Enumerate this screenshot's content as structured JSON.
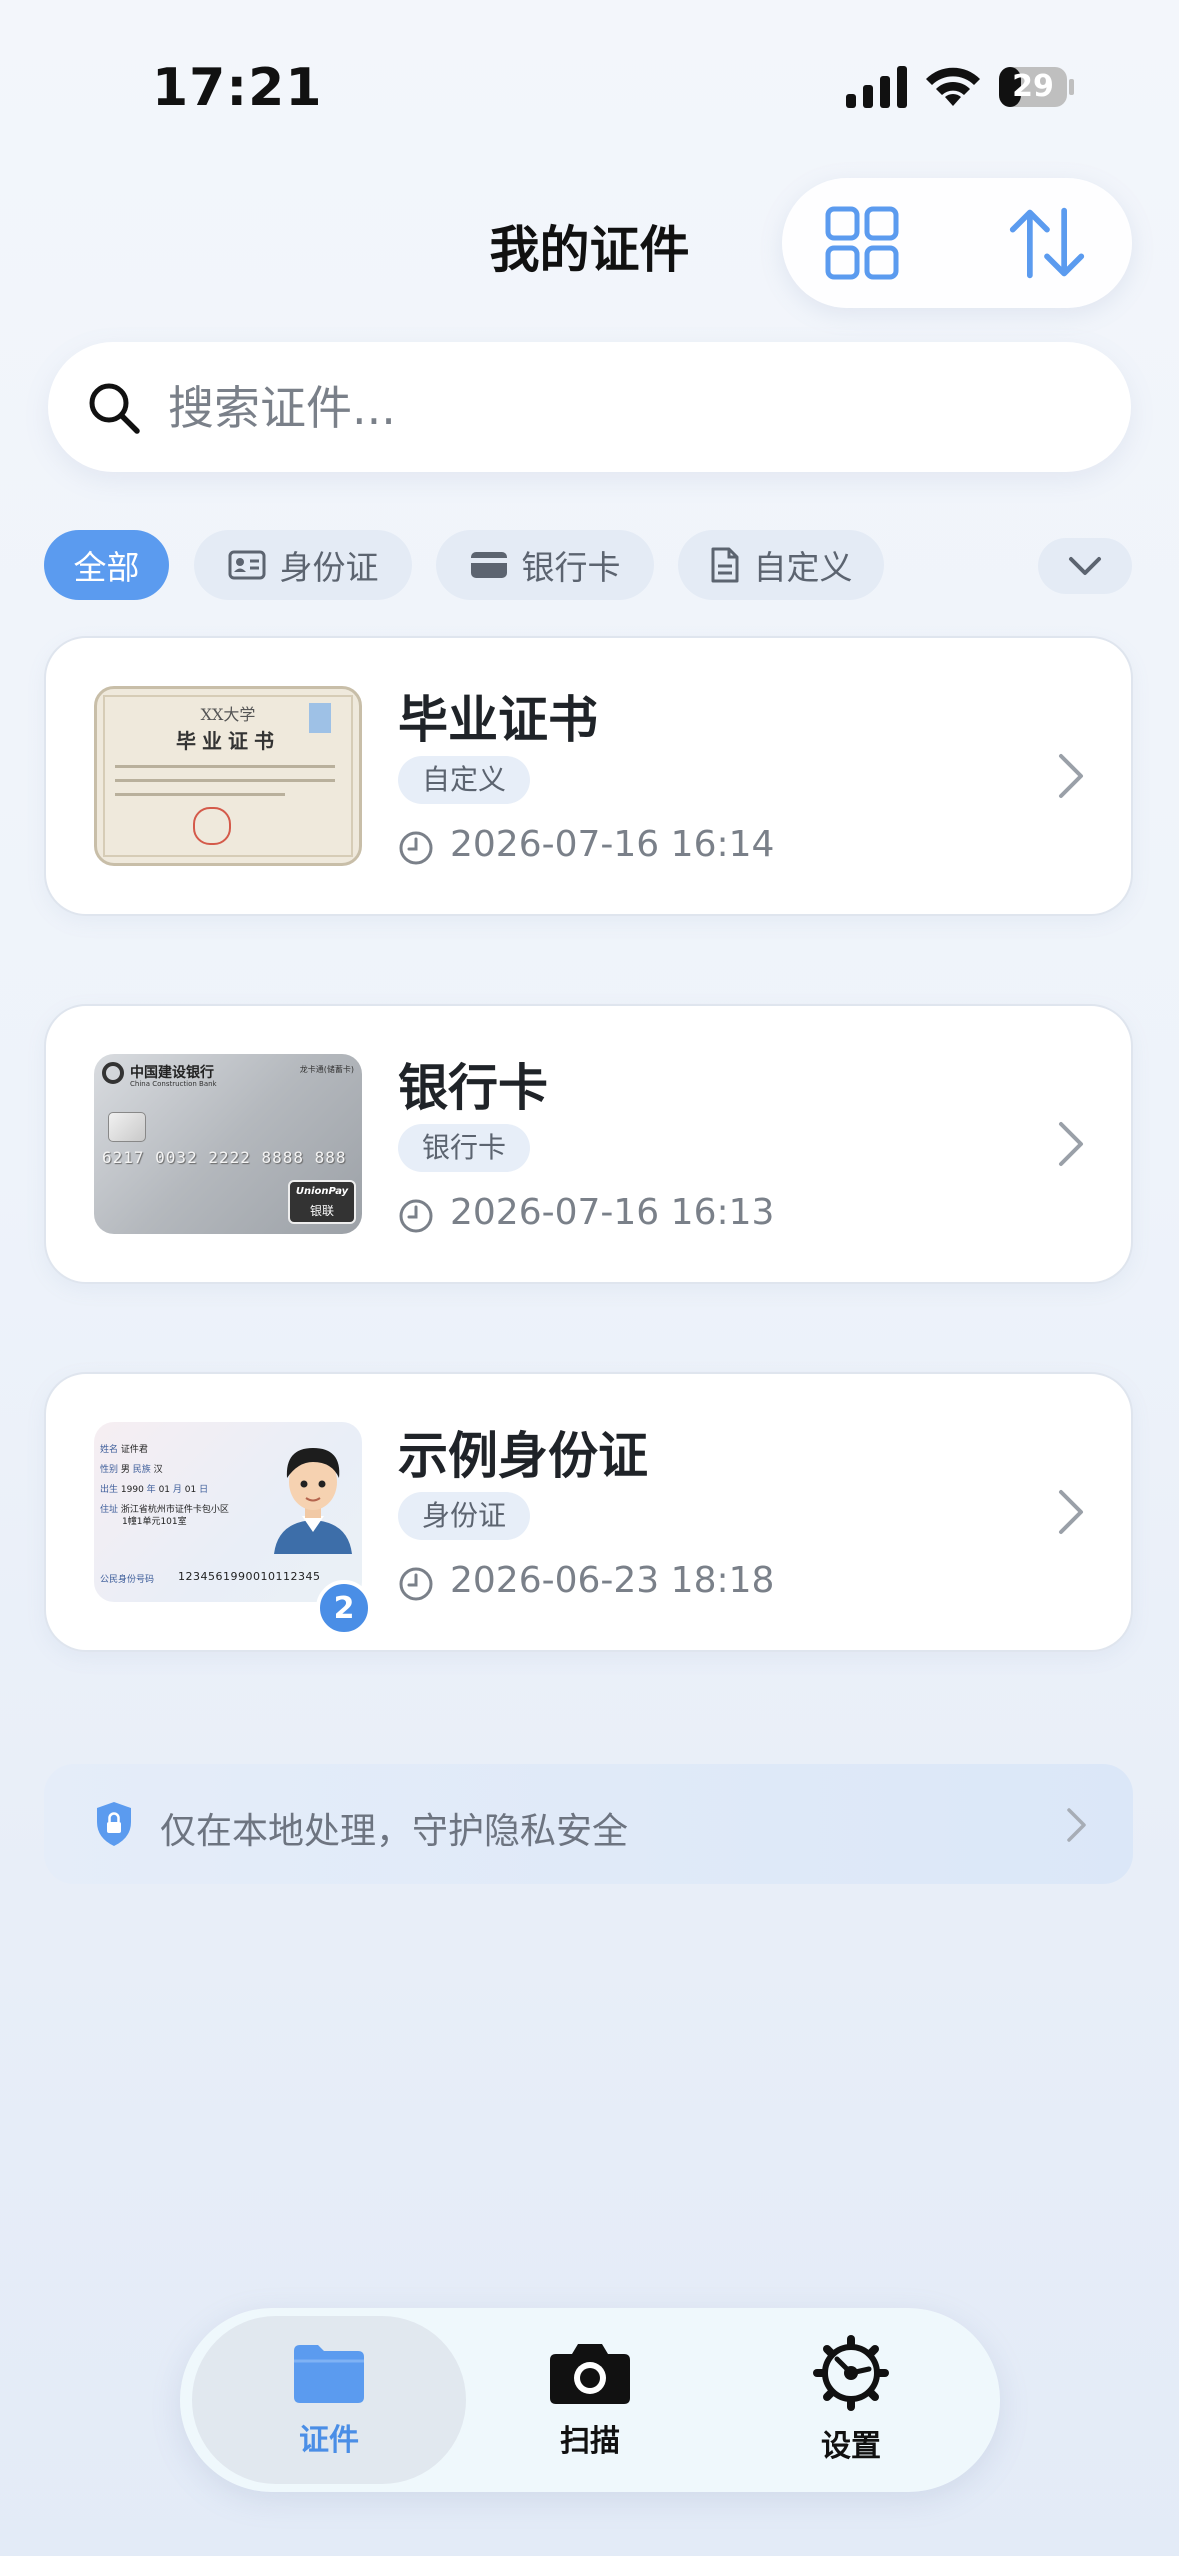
{
  "status_bar": {
    "time": "17:21",
    "battery": "29"
  },
  "header": {
    "title": "我的证件",
    "grid_icon": "grid-view-icon",
    "sort_icon": "sort-icon"
  },
  "search": {
    "placeholder": "搜索证件...",
    "icon": "search-icon"
  },
  "filters": [
    {
      "label": "全部",
      "active": true
    },
    {
      "label": "身份证",
      "icon": "id-card-icon"
    },
    {
      "label": "银行卡",
      "icon": "bank-card-icon"
    },
    {
      "label": "自定义",
      "icon": "document-icon"
    }
  ],
  "documents": [
    {
      "name": "毕业证书",
      "tag": "自定义",
      "time": "2026-07-16 16:14",
      "thumb": {
        "school": "XX大学",
        "title": "毕业证书"
      }
    },
    {
      "name": "银行卡",
      "tag": "银行卡",
      "time": "2026-07-16 16:13",
      "thumb": {
        "bank": "中国建设银行",
        "bank_en": "China Construction Bank",
        "number": "6217 0032 2222 8888 888",
        "brand": "UnionPay",
        "brand_cn": "银联",
        "card_type": "龙卡通(储蓄卡)"
      }
    },
    {
      "name": "示例身份证",
      "tag": "身份证",
      "time": "2026-06-23 18:18",
      "badge": "2",
      "thumb": {
        "name_label": "姓名",
        "name": "证件君",
        "sex_label": "性别",
        "sex": "男",
        "nation_label": "民族",
        "nation": "汉",
        "birth_label": "出生",
        "year": "1990",
        "year_unit": "年",
        "month": "01",
        "month_unit": "月",
        "day": "01",
        "day_unit": "日",
        "address_label": "住址",
        "address1": "浙江省杭州市证件卡包小区",
        "address2": "1幢1单元101室",
        "id_label": "公民身份号码",
        "id_number": "1234561990010112345"
      }
    }
  ],
  "privacy": {
    "text": "仅在本地处理，守护隐私安全",
    "icon": "lock-shield-icon"
  },
  "tabbar": [
    {
      "label": "证件",
      "icon": "folder-icon",
      "active": true
    },
    {
      "label": "扫描",
      "icon": "camera-icon"
    },
    {
      "label": "设置",
      "icon": "gear-icon"
    }
  ],
  "colors": {
    "accent": "#5b9bef",
    "active_tab_text": "#4a8ee6",
    "chip_bg": "#e4ebf5",
    "card_border": "#dfe5ee"
  }
}
